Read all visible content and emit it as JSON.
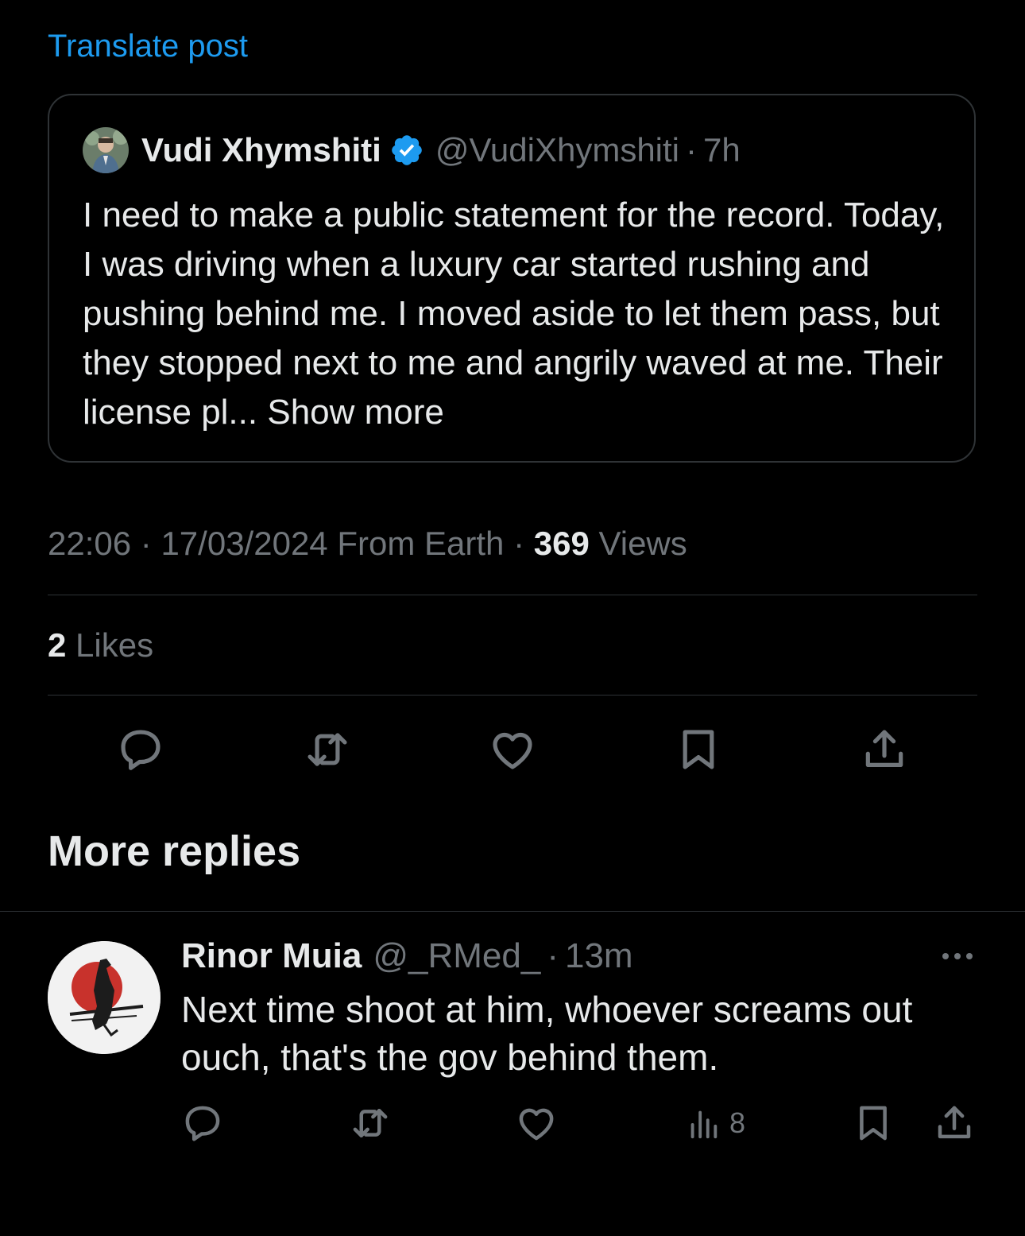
{
  "translate_label": "Translate post",
  "quoted_post": {
    "display_name": "Vudi Xhymshiti",
    "handle": "@VudiXhymshiti",
    "separator": "·",
    "time": "7h",
    "text": "I need to make a public statement for the record. Today, I was driving when a luxury car started rushing and pushing behind me. I moved aside to let them pass, but they stopped next to me and angrily waved at me. Their license pl...",
    "show_more": "Show more"
  },
  "post_meta": {
    "time": "22:06",
    "sep1": "·",
    "date": "17/03/2024",
    "source": "From Earth",
    "sep2": "·",
    "views_count": "369",
    "views_label": "Views"
  },
  "likes": {
    "count": "2",
    "label": "Likes"
  },
  "actions": [
    "reply-icon",
    "repost-icon",
    "like-icon",
    "bookmark-icon",
    "share-icon"
  ],
  "more_replies_heading": "More replies",
  "reply": {
    "display_name": "Rinor Muia",
    "handle": "@_RMed_",
    "separator": "·",
    "time": "13m",
    "text": "Next time shoot at him, whoever screams out ouch, that's the gov behind them.",
    "views": "8"
  },
  "colors": {
    "background": "#000000",
    "link": "#1d9bf0",
    "primary_text": "#e7e9ea",
    "secondary_text": "#71767b",
    "border": "#2f3336",
    "verified": "#1d9bf0"
  }
}
